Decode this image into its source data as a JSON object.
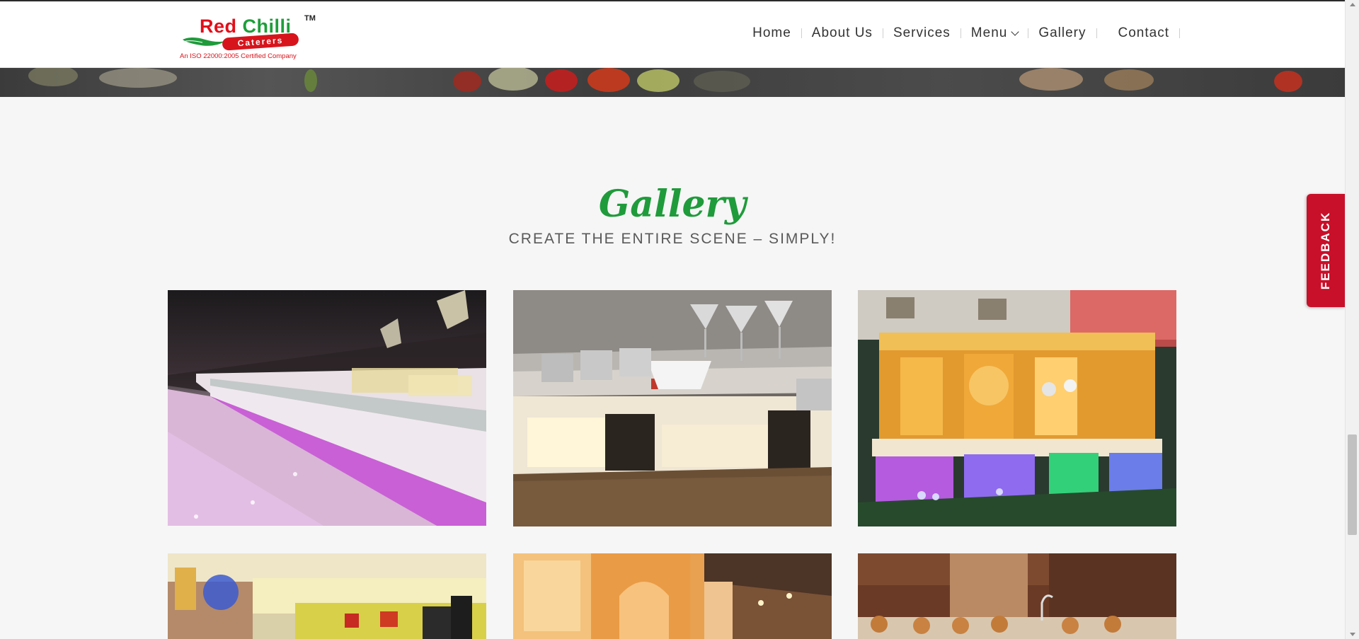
{
  "logo": {
    "word_red": "Red",
    "word_green": "Chilli",
    "tm": "TM",
    "ribbon": "Caterers",
    "tagline": "An ISO 22000:2005 Certified Company"
  },
  "nav": {
    "items": [
      {
        "label": "Home"
      },
      {
        "label": "About Us"
      },
      {
        "label": "Services"
      },
      {
        "label": "Menu"
      },
      {
        "label": "Gallery"
      },
      {
        "label": "Contact"
      }
    ]
  },
  "gallery": {
    "title": "Gallery",
    "subtitle": "CREATE THE ENTIRE SCENE – SIMPLY!",
    "photos": [
      {
        "icon": "buffet-counter-purple-lights-photo"
      },
      {
        "icon": "buffet-counter-martini-glasses-photo"
      },
      {
        "icon": "outdoor-buffet-golden-backdrop-photo"
      },
      {
        "icon": "tent-buffet-yellow-lights-photo"
      },
      {
        "icon": "arched-hall-orange-photo"
      },
      {
        "icon": "copper-chafing-dishes-photo"
      }
    ]
  },
  "feedback": {
    "label": "FEEDBACK"
  },
  "colors": {
    "brand_green": "#1f9b3b",
    "brand_red": "#c9102a",
    "nav_text": "#333333",
    "page_bg": "#f6f6f6"
  }
}
